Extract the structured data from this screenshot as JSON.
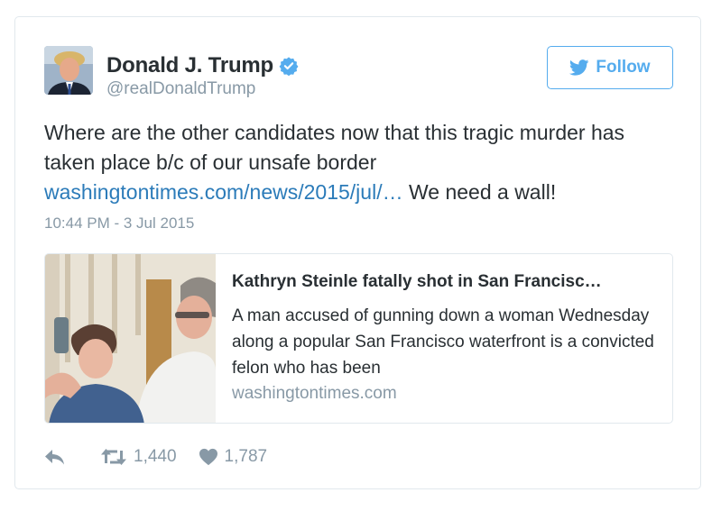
{
  "author": {
    "display_name": "Donald J. Trump",
    "handle": "@realDonaldTrump",
    "verified": true
  },
  "follow_button": {
    "label": "Follow",
    "icon": "twitter-bird-icon",
    "color": "#55acee"
  },
  "tweet": {
    "text": "Where are the other candidates now that this tragic murder has taken place b/c of our unsafe border",
    "link_text": "washingtontimes.com/news/2015/jul/…",
    "text_after_link": " We need a wall!",
    "timestamp": "10:44 PM - 3 Jul 2015",
    "link_color": "#2b7bb9"
  },
  "link_card": {
    "title": "Kathryn Steinle fatally shot in San Francisc…",
    "description": "A man accused of gunning down a woman Wednesday along a popular San Francisco waterfront is a convicted felon who has been",
    "domain": "washingtontimes.com"
  },
  "actions": {
    "reply": {
      "icon": "reply-icon"
    },
    "retweet": {
      "icon": "retweet-icon",
      "count": "1,440"
    },
    "like": {
      "icon": "heart-icon",
      "count": "1,787"
    }
  }
}
